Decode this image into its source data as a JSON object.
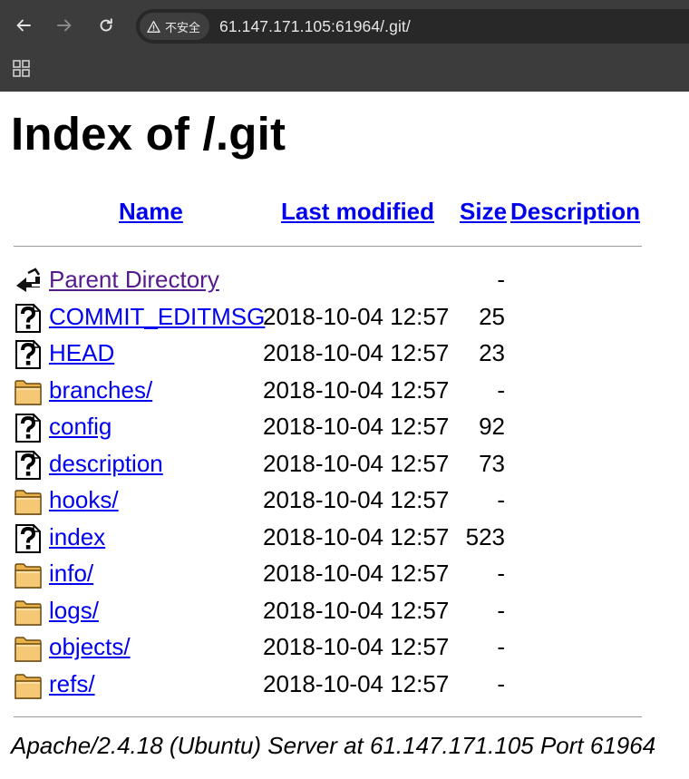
{
  "browser": {
    "security_label": "不安全",
    "url": "61.147.171.105:61964/.git/"
  },
  "page": {
    "title": "Index of /.git",
    "headers": {
      "name": "Name",
      "last_modified": "Last modified",
      "size": "Size",
      "description": "Description"
    },
    "rows": [
      {
        "icon": "back-icon",
        "name": "Parent Directory",
        "date": "",
        "size": "-"
      },
      {
        "icon": "unknown-file-icon",
        "name": "COMMIT_EDITMSG",
        "date": "2018-10-04 12:57",
        "size": "25"
      },
      {
        "icon": "unknown-file-icon",
        "name": "HEAD",
        "date": "2018-10-04 12:57",
        "size": "23"
      },
      {
        "icon": "folder-icon",
        "name": "branches/",
        "date": "2018-10-04 12:57",
        "size": "-"
      },
      {
        "icon": "unknown-file-icon",
        "name": "config",
        "date": "2018-10-04 12:57",
        "size": "92"
      },
      {
        "icon": "unknown-file-icon",
        "name": "description",
        "date": "2018-10-04 12:57",
        "size": "73"
      },
      {
        "icon": "folder-icon",
        "name": "hooks/",
        "date": "2018-10-04 12:57",
        "size": "-"
      },
      {
        "icon": "unknown-file-icon",
        "name": "index",
        "date": "2018-10-04 12:57",
        "size": "523"
      },
      {
        "icon": "folder-icon",
        "name": "info/",
        "date": "2018-10-04 12:57",
        "size": "-"
      },
      {
        "icon": "folder-icon",
        "name": "logs/",
        "date": "2018-10-04 12:57",
        "size": "-"
      },
      {
        "icon": "folder-icon",
        "name": "objects/",
        "date": "2018-10-04 12:57",
        "size": "-"
      },
      {
        "icon": "folder-icon",
        "name": "refs/",
        "date": "2018-10-04 12:57",
        "size": "-"
      }
    ],
    "footer": "Apache/2.4.18 (Ubuntu) Server at 61.147.171.105 Port 61964"
  },
  "colors": {
    "link": "#0000ee",
    "visited_link": "#551a8b",
    "chrome_bg": "#3c3c3c",
    "omnibox_bg": "#282828"
  }
}
